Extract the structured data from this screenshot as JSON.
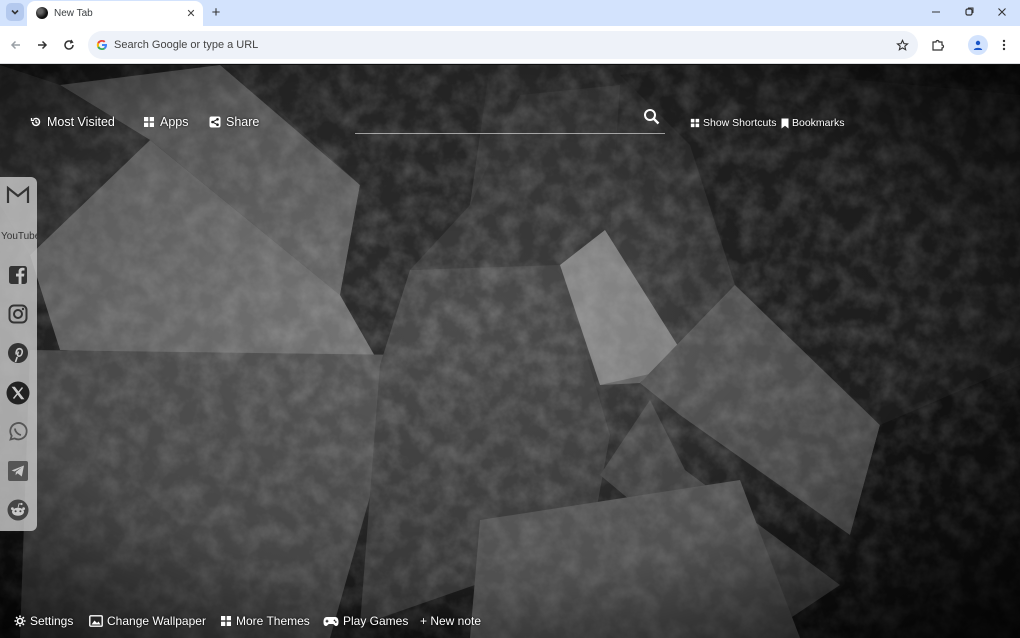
{
  "browser": {
    "tab": {
      "title": "New Tab"
    },
    "omnibox": {
      "placeholder": "Search Google or type a URL"
    }
  },
  "newtab": {
    "top_left_links": [
      {
        "label": "Most Visited",
        "icon": "history-icon"
      },
      {
        "label": "Apps",
        "icon": "grid-icon"
      },
      {
        "label": "Share",
        "icon": "share-icon"
      }
    ],
    "search": {
      "placeholder": ""
    },
    "top_right_links": [
      {
        "label": "Show Shortcuts",
        "icon": "grid-icon"
      },
      {
        "label": "Bookmarks",
        "icon": "bookmark-icon"
      }
    ],
    "social_icons": [
      "gmail-icon",
      "youtube-icon",
      "facebook-icon",
      "instagram-icon",
      "pinterest-icon",
      "x-icon",
      "whatsapp-icon",
      "telegram-icon",
      "reddit-icon"
    ],
    "bottom_links": [
      {
        "label": "Settings",
        "icon": "gear-icon"
      },
      {
        "label": "Change Wallpaper",
        "icon": "image-icon"
      },
      {
        "label": "More Themes",
        "icon": "grid-icon"
      },
      {
        "label": "Play Games",
        "icon": "gamepad-icon"
      },
      {
        "label": "+ New note",
        "icon": ""
      }
    ],
    "youtube_text": "YouTube"
  }
}
